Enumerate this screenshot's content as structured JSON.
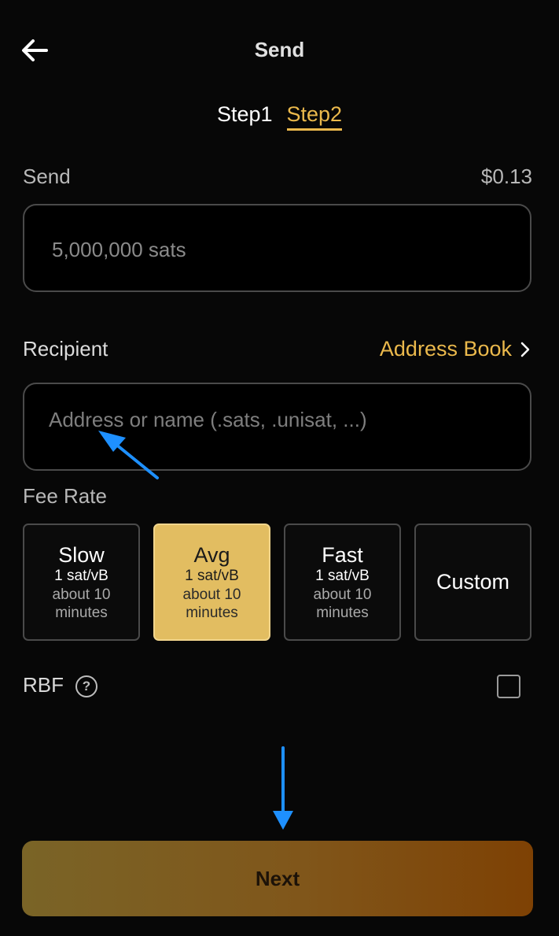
{
  "header": {
    "back_icon": "arrow-left-icon",
    "title": "Send"
  },
  "steps": {
    "step1": "Step1",
    "step2": "Step2",
    "active_color": "#ebb94c"
  },
  "amount": {
    "label": "Send",
    "usd_value": "$0.13",
    "value": "5,000,000 sats"
  },
  "recipient": {
    "label": "Recipient",
    "address_book_label": "Address Book",
    "address_book_icon": "chevron-right-icon",
    "placeholder": "Address or name (.sats, .unisat, ...)"
  },
  "fee": {
    "label": "Fee Rate",
    "options": [
      {
        "title": "Slow",
        "rate": "1 sat/vB",
        "time_line1": "about 10",
        "time_line2": "minutes"
      },
      {
        "title": "Avg",
        "rate": "1 sat/vB",
        "time_line1": "about 10",
        "time_line2": "minutes"
      },
      {
        "title": "Fast",
        "rate": "1 sat/vB",
        "time_line1": "about 10",
        "time_line2": "minutes"
      },
      {
        "title": "Custom"
      }
    ],
    "selected": "Avg",
    "selected_color": "#e2bd61"
  },
  "rbf": {
    "label": "RBF",
    "help_icon": "question-circle-icon",
    "help_glyph": "?",
    "checked": false
  },
  "next_button": {
    "label": "Next"
  },
  "annotations": {
    "arrow_color": "#1e90ff",
    "arrows": [
      "pointer-arrow-icon",
      "down-arrow-icon"
    ]
  }
}
